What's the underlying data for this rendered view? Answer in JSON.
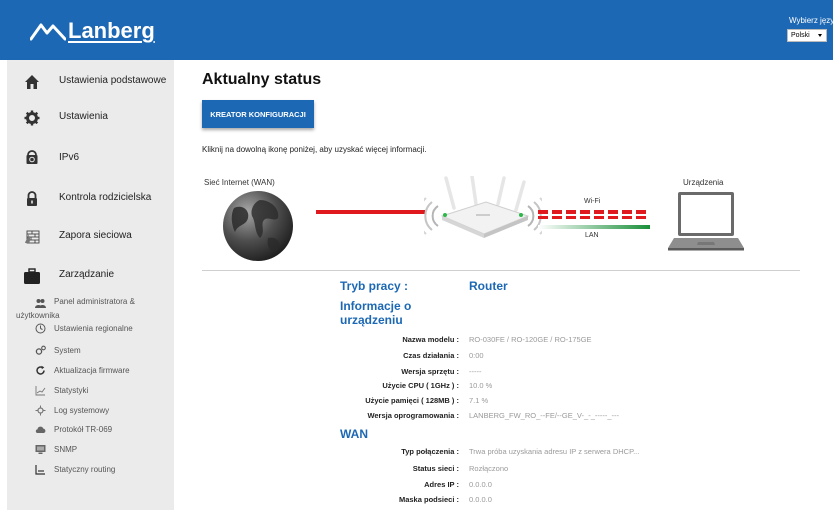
{
  "brand": {
    "name": "Lanberg",
    "color": "#1c68b4"
  },
  "language": {
    "label": "Wybierz język",
    "selected": "Polski"
  },
  "sidebar": {
    "main_items": [
      {
        "label": "Ustawienia podstawowe",
        "icon": "home-icon"
      },
      {
        "label": "Ustawienia",
        "icon": "gear-icon"
      },
      {
        "label": "IPv6",
        "icon": "globe-lock-icon"
      },
      {
        "label": "Kontrola rodzicielska",
        "icon": "lock-icon"
      },
      {
        "label": "Zapora sieciowa",
        "icon": "firewall-icon"
      },
      {
        "label": "Zarządzanie",
        "icon": "briefcase-icon"
      }
    ],
    "sub_items": [
      {
        "label": "Panel administratora &",
        "label2": "użytkownika",
        "icon": "users-icon"
      },
      {
        "label": "Ustawienia regionalne",
        "icon": "clock-icon"
      },
      {
        "label": "System",
        "icon": "gears-icon"
      },
      {
        "label": "Aktualizacja firmware",
        "icon": "refresh-icon"
      },
      {
        "label": "Statystyki",
        "icon": "chart-icon"
      },
      {
        "label": "Log systemowy",
        "icon": "log-icon"
      },
      {
        "label": "Protokół TR-069",
        "icon": "cloud-icon"
      },
      {
        "label": "SNMP",
        "icon": "monitor-icon"
      },
      {
        "label": "Statyczny routing",
        "icon": "route-icon"
      }
    ]
  },
  "main": {
    "title": "Aktualny status",
    "wizard_button": "KREATOR KONFIGURACJI",
    "hint": "Kliknij na dowolną ikonę poniżej, aby uzyskać więcej informacji."
  },
  "diagram": {
    "wan_label": "Sieć Internet (WAN)",
    "devices_label": "Urządzenia",
    "wifi_label": "Wi-Fi",
    "lan_label": "LAN",
    "wan_link_color": "#e0191e",
    "lan_link_color": "#1a8f3a"
  },
  "status": {
    "mode_key": "Tryb pracy :",
    "mode_value": "Router",
    "device_section": "Informacje o urządzeniu",
    "device_rows": [
      {
        "key": "Nazwa modelu :",
        "value": "RO-030FE / RO-120GE / RO-175GE"
      },
      {
        "key": "Czas działania :",
        "value": "0:00"
      },
      {
        "key": "Wersja sprzętu :",
        "value": "-----"
      },
      {
        "key": "Użycie CPU ( 1GHz ) :",
        "value": "10.0 %"
      },
      {
        "key": "Użycie pamięci ( 128MB ) :",
        "value": "7.1 %"
      },
      {
        "key": "Wersja oprogramowania :",
        "value": "LANBERG_FW_RO_--FE/--GE_V-_-_-----_---"
      }
    ],
    "wan_section": "WAN",
    "wan_rows": [
      {
        "key": "Typ połączenia :",
        "value": "Trwa próba uzyskania adresu IP z serwera DHCP..."
      },
      {
        "key": "Status sieci :",
        "value": "Rozłączono"
      },
      {
        "key": "Adres IP :",
        "value": "0.0.0.0"
      },
      {
        "key": "Maska podsieci :",
        "value": "0.0.0.0"
      }
    ]
  }
}
